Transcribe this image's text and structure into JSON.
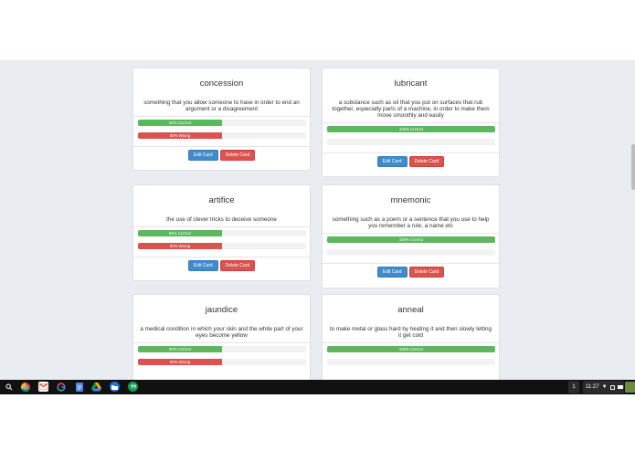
{
  "cards": [
    {
      "word": "concession",
      "definition": "something that you allow someone to have in order to end an argument or a disagreement",
      "correct_label": "50% Correct",
      "correct_pct": 50,
      "wrong_label": "50% Wrong",
      "wrong_pct": 50,
      "edit_label": "Edit Card",
      "delete_label": "Delete Card"
    },
    {
      "word": "lubricant",
      "definition": "a substance such as oil that you put on surfaces that rub together, especially parts of a machine, in order to make them move smoothly and easily",
      "correct_label": "100% Correct",
      "correct_pct": 100,
      "wrong_pct": 0,
      "edit_label": "Edit Card",
      "delete_label": "Delete Card"
    },
    {
      "word": "artifice",
      "definition": "the use of clever tricks to deceive someone",
      "correct_label": "50% Correct",
      "correct_pct": 50,
      "wrong_label": "50% Wrong",
      "wrong_pct": 50,
      "edit_label": "Edit Card",
      "delete_label": "Delete Card"
    },
    {
      "word": "mnemonic",
      "definition": "something such as a poem or a sentence that you use to help you remember a rule, a name etc",
      "correct_label": "100% Correct",
      "correct_pct": 100,
      "wrong_pct": 0,
      "edit_label": "Edit Card",
      "delete_label": "Delete Card"
    },
    {
      "word": "jaundice",
      "definition": "a medical condition in which your skin and the white part of your eyes become yellow",
      "correct_label": "50% Correct",
      "correct_pct": 50,
      "wrong_label": "50% Wrong",
      "wrong_pct": 50
    },
    {
      "word": "anneal",
      "definition": "to make metal or glass hard by heating it and then slowly letting it get cold",
      "correct_label": "100% Correct",
      "correct_pct": 100,
      "wrong_pct": 0
    }
  ],
  "taskbar": {
    "apps": [
      {
        "icon": "search-icon",
        "color": "#111111"
      },
      {
        "icon": "chrome-icon",
        "color": "#db4437"
      },
      {
        "icon": "gmail-icon",
        "color": "#ea4335"
      },
      {
        "icon": "google-search-icon",
        "color": "#4285f4"
      },
      {
        "icon": "docs-icon",
        "color": "#4285f4"
      },
      {
        "icon": "drive-icon",
        "color": "#0f9d58"
      },
      {
        "icon": "files-icon",
        "color": "#1a73e8"
      },
      {
        "icon": "hangouts-icon",
        "color": "#0f9d58"
      }
    ],
    "desk_indicator": "1",
    "clock": "11:27"
  }
}
